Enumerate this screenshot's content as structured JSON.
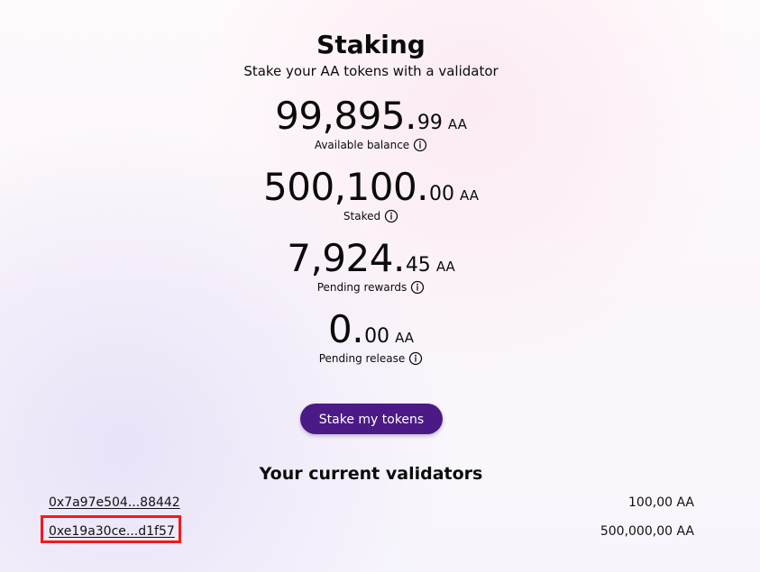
{
  "header": {
    "title": "Staking",
    "subtitle": "Stake your AA tokens with a validator"
  },
  "metrics": [
    {
      "whole": "99,895.",
      "decimal": "99",
      "unit": "AA",
      "label": "Available balance",
      "icon": "info-icon"
    },
    {
      "whole": "500,100.",
      "decimal": "00",
      "unit": "AA",
      "label": "Staked",
      "icon": "info-icon"
    },
    {
      "whole": "7,924.",
      "decimal": "45",
      "unit": "AA",
      "label": "Pending rewards",
      "icon": "info-icon"
    },
    {
      "whole": "0.",
      "decimal": "00",
      "unit": "AA",
      "label": "Pending release",
      "icon": "info-icon"
    }
  ],
  "actions": {
    "stake_button_label": "Stake my tokens"
  },
  "validators": {
    "title": "Your current validators",
    "items": [
      {
        "address": "0x7a97e504...88442",
        "amount": "100,00 AA"
      },
      {
        "address": "0xe19a30ce...d1f57",
        "amount": "500,000,00 AA"
      }
    ]
  },
  "colors": {
    "button": "#4b1a86",
    "highlight": "#f11b1b"
  }
}
